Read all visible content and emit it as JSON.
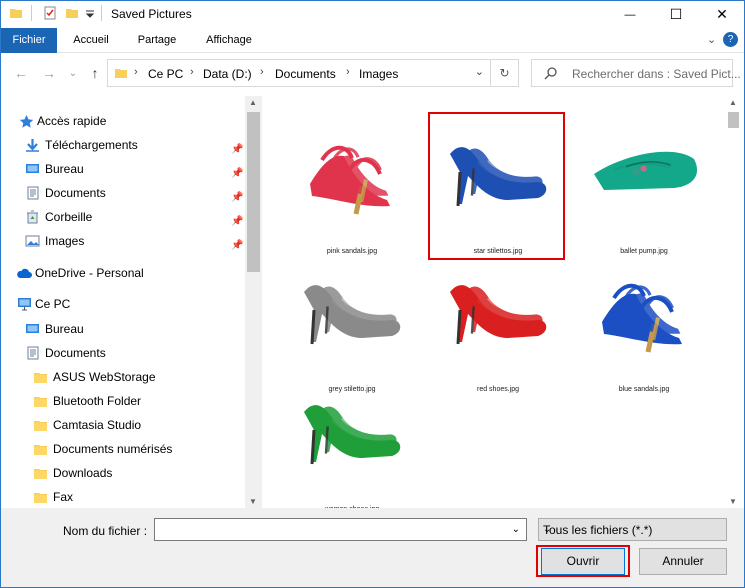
{
  "window": {
    "title": "Saved Pictures",
    "minimize": "—",
    "maximize": "☐",
    "close": "✕"
  },
  "ribbon": {
    "tabs": [
      "Fichier",
      "Accueil",
      "Partage",
      "Affichage"
    ],
    "help": "?"
  },
  "nav": {
    "back": "←",
    "forward": "→",
    "recent": "⌄",
    "up": "↑"
  },
  "address": {
    "crumbs": [
      "Ce PC",
      "Data (D:)",
      "Documents",
      "Images"
    ],
    "sep": "›",
    "dropdown": "⌄",
    "refresh": "↻"
  },
  "search": {
    "placeholder": "Rechercher dans : Saved Pict..."
  },
  "navpane": {
    "items": [
      {
        "label": "Accès rapide",
        "icon": "star-icon"
      },
      {
        "label": "Téléchargements",
        "icon": "download-icon"
      },
      {
        "label": "Bureau",
        "icon": "desktop-icon"
      },
      {
        "label": "Documents",
        "icon": "documents-icon"
      },
      {
        "label": "Corbeille",
        "icon": "recycle-bin-icon"
      },
      {
        "label": "Images",
        "icon": "pictures-icon"
      },
      {
        "label": "OneDrive - Personal",
        "icon": "cloud-icon"
      },
      {
        "label": "Ce PC",
        "icon": "computer-icon"
      },
      {
        "label": "Bureau",
        "icon": "desktop-icon"
      },
      {
        "label": "Documents",
        "icon": "documents-icon"
      },
      {
        "label": "ASUS WebStorage",
        "icon": "folder-icon"
      },
      {
        "label": "Bluetooth Folder",
        "icon": "folder-icon"
      },
      {
        "label": "Camtasia Studio",
        "icon": "folder-icon"
      },
      {
        "label": "Documents numérisés",
        "icon": "folder-icon"
      },
      {
        "label": "Downloads",
        "icon": "folder-icon"
      },
      {
        "label": "Fax",
        "icon": "folder-icon"
      }
    ]
  },
  "files": [
    {
      "name": "pink sandals.jpg",
      "color": "#e0344d"
    },
    {
      "name": "star stilettos.jpg",
      "color": "#1e4fb3"
    },
    {
      "name": "ballet pump.jpg",
      "color": "#14a88a"
    },
    {
      "name": "grey stiletto.jpg",
      "color": "#8a8a8a"
    },
    {
      "name": "red shoes.jpg",
      "color": "#d91f1f"
    },
    {
      "name": "blue sandals.jpg",
      "color": "#1c4ec4"
    },
    {
      "name": "women shoes.jpg",
      "color": "#1f9e3a"
    }
  ],
  "footer": {
    "filename_label": "Nom du fichier :",
    "filename_value": "",
    "filetype": "Tous les fichiers (*.*)",
    "open": "Ouvrir",
    "cancel": "Annuler"
  }
}
